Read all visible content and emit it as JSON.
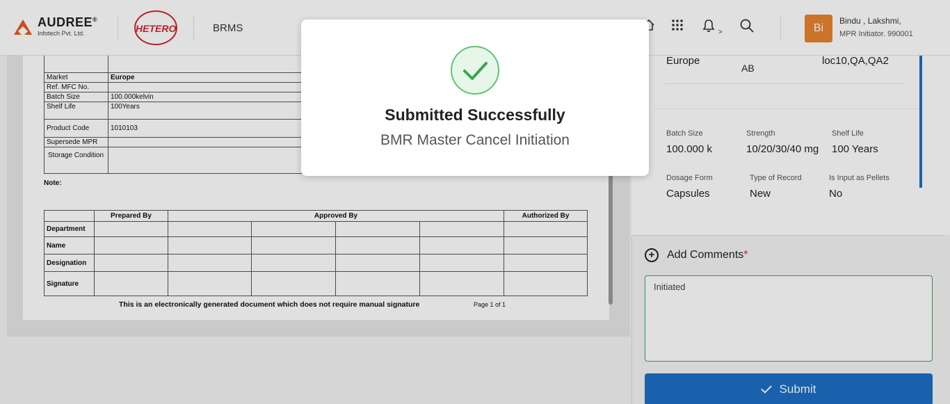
{
  "header": {
    "brand_name": "AUDREE",
    "brand_mark": "®",
    "brand_sub": "Infotech Pvt. Ltd.",
    "partner_logo": "HETERO",
    "app_title": "BRMS",
    "user_name": "Bindu , Lakshmi,",
    "user_role": "MPR Initiator. 990001",
    "avatar_initials": "Bi",
    "notif_suffix": ">"
  },
  "document": {
    "meta_rows": [
      {
        "label": "Market",
        "value": "Europe"
      },
      {
        "label": "Ref. MFC No.",
        "value": ""
      },
      {
        "label": "Batch Size",
        "value": "100.000kelvin"
      },
      {
        "label": "Shelf Life",
        "value": "100Years"
      },
      {
        "label": "Product Code",
        "value": "1010103"
      },
      {
        "label": "Supersede MPR",
        "value": ""
      },
      {
        "label": "Storage Condition",
        "value": ""
      }
    ],
    "note_label": "Note:",
    "sign_headers": {
      "prepared": "Prepared By",
      "approved": "Approved By",
      "authorized": "Authorized By"
    },
    "sign_rows": [
      "Department",
      "Name",
      "Designation",
      "Signature"
    ],
    "footer_text": "This is an electronically generated document which does not require manual signature",
    "page_text": "Page 1 of 1"
  },
  "details": {
    "market": "Europe",
    "partial_ab": "AB",
    "locations": "loc10,QA,QA2",
    "batch_size_label": "Batch Size",
    "batch_size": "100.000 k",
    "strength_label": "Strength",
    "strength": "10/20/30/40 mg",
    "shelf_life_label": "Shelf Life",
    "shelf_life": "100 Years",
    "dosage_form_label": "Dosage Form",
    "dosage_form": "Capsules",
    "type_of_record_label": "Type of Record",
    "type_of_record": "New",
    "pellets_label": "Is Input as Pellets",
    "pellets": "No"
  },
  "comments": {
    "title": "Add Comments",
    "required_mark": "*",
    "value": "Initiated",
    "submit_label": "Submit"
  },
  "modal": {
    "title": "Submitted Successfully",
    "subtitle": "BMR Master Cancel Initiation"
  },
  "colors": {
    "accent_blue": "#1d6fc4",
    "success_green": "#3aa651",
    "brand_orange": "#e8852f",
    "hetero_red": "#d4262c"
  }
}
